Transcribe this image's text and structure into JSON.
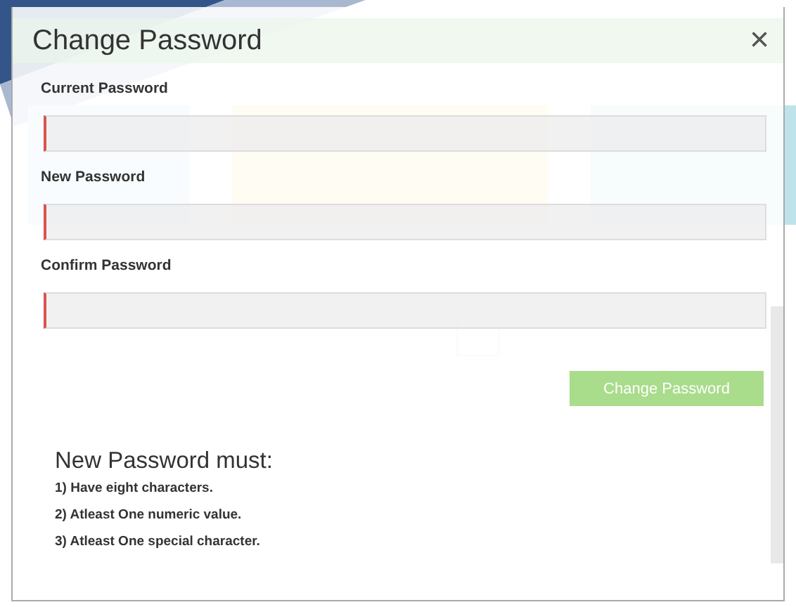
{
  "dialog": {
    "title": "Change Password",
    "close": "×",
    "fields": [
      {
        "label": "Current Password",
        "invalid": true
      },
      {
        "label": "New Password",
        "invalid": true
      },
      {
        "label": "Confirm Password",
        "invalid": true
      }
    ],
    "submit": "Change Password",
    "rules_title": "New Password must:",
    "rules": [
      "1) Have eight characters.",
      "2) Atleast One numeric value.",
      "3) Atleast One special character."
    ]
  }
}
